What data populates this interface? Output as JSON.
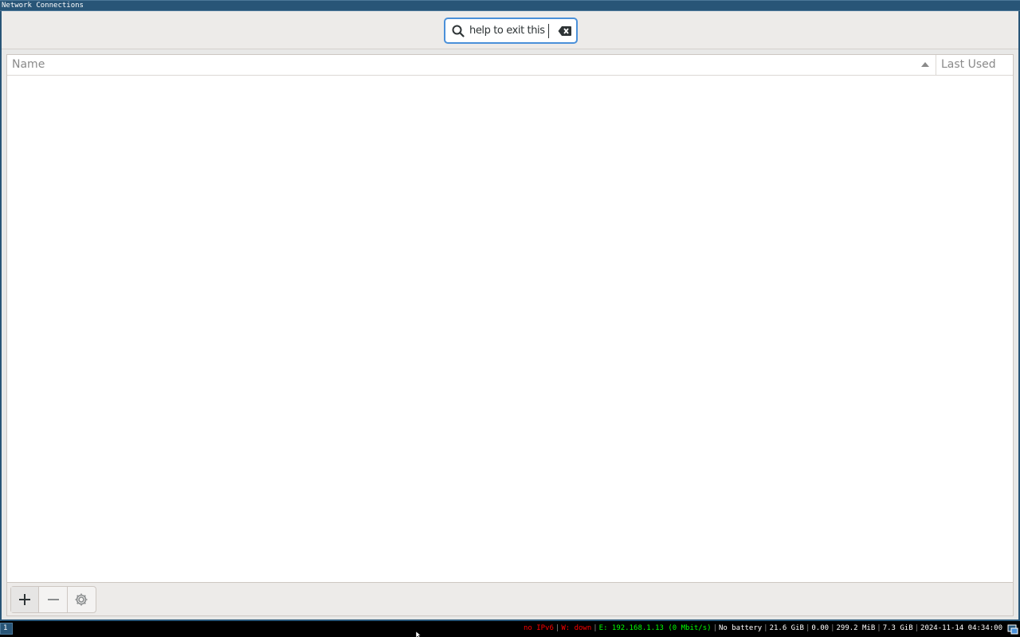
{
  "window": {
    "title": "Network Connections"
  },
  "search": {
    "value": "help to exit this"
  },
  "columns": {
    "name": "Name",
    "last_used": "Last Used"
  },
  "toolbar": {
    "add": "+",
    "remove": "−"
  },
  "i3bar": {
    "workspace": "1",
    "ipv6": "no IPv6",
    "wifi": "W: down",
    "ethernet": "E: 192.168.1.13 (0 Mbit/s)",
    "battery": "No battery",
    "disk": "21.6 GiB",
    "load": "0.00",
    "memory": "299.2 MiB",
    "memory_total": "7.3 GiB",
    "datetime": "2024-11-14 04:34:00"
  },
  "colors": {
    "accent": "#4a90d9",
    "titlebar": "#285577",
    "status_red": "#ff0000",
    "status_green": "#00ff00"
  },
  "icons": [
    "search-icon",
    "clear-icon",
    "sort-ascending-icon",
    "plus-icon",
    "minus-icon",
    "gear-icon",
    "tray-icon"
  ]
}
